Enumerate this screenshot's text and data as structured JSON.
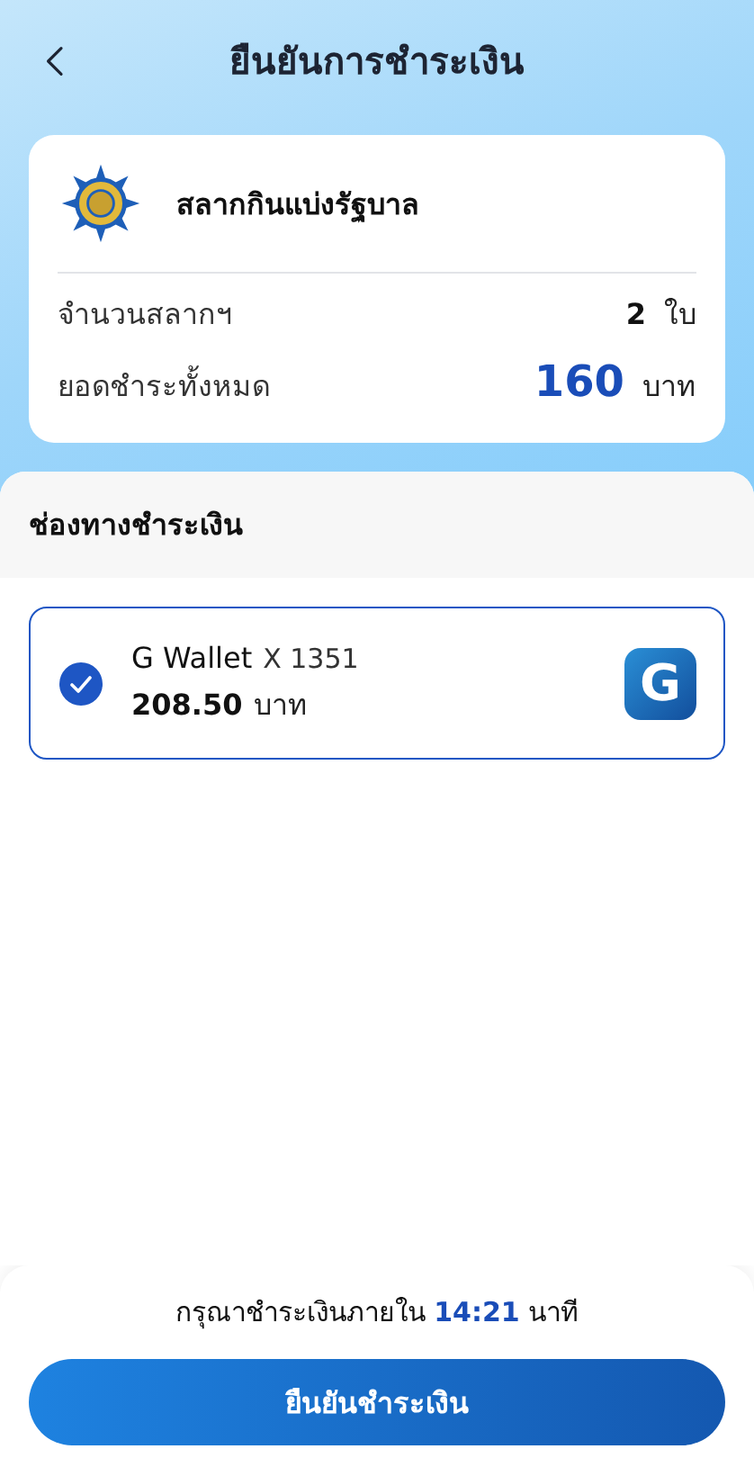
{
  "header": {
    "title": "ยืนยันการชำระเงิน"
  },
  "summary": {
    "name": "สลากกินแบ่งรัฐบาล",
    "rows": [
      {
        "kind": "count",
        "label": "จำนวนสลากฯ",
        "value": "2",
        "unit": "ใบ"
      },
      {
        "kind": "total",
        "label": "ยอดชำระทั้งหมด",
        "value": "160",
        "unit": "บาท"
      }
    ]
  },
  "payment": {
    "title": "ช่องทางชำระเงิน",
    "methods": [
      {
        "name": "G Wallet",
        "account": "X 1351",
        "amount": "208.50",
        "unit": "บาท",
        "logo_text": "G",
        "selected": true
      }
    ]
  },
  "footer": {
    "timer": "กรุณาชำระเงินภายใน **14:21** นาที",
    "button": "ยืนยันชำระเงิน"
  }
}
